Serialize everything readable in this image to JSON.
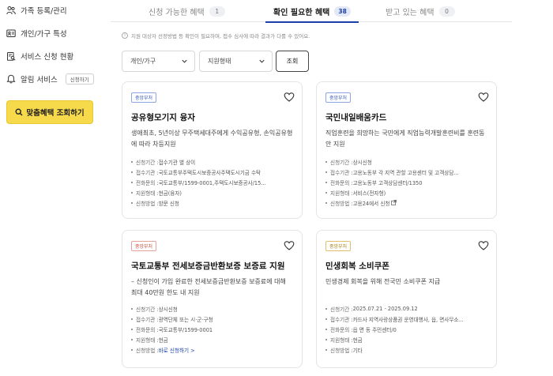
{
  "sidebar": {
    "items": [
      {
        "label": "가족 등록/관리",
        "icon": "people-icon"
      },
      {
        "label": "개인/가구 특성",
        "icon": "id-card-icon"
      },
      {
        "label": "서비스 신청 현황",
        "icon": "clipboard-search-icon"
      },
      {
        "label": "알림 서비스",
        "icon": "bell-icon",
        "button": "신청하기"
      }
    ],
    "cta_label": "맞춤혜택 조회하기"
  },
  "tabs": [
    {
      "label": "신청 가능한 혜택",
      "count": "1"
    },
    {
      "label": "확인 필요한 혜택",
      "count": "38"
    },
    {
      "label": "받고 있는 혜택",
      "count": "0"
    }
  ],
  "notice": "지원 대상자 선정방법 등 확인이 필요하며, 접수 심사에 따라 결과가 다를 수 있어요.",
  "filters": {
    "household": "개인/가구",
    "support_type": "지원형태",
    "search_label": "조회"
  },
  "cards": [
    {
      "badge": "중앙부처",
      "badge_color": "blue",
      "title": "공유형모기지 융자",
      "desc": "생애최초, 5년이상 무주택세대주에게 수익공유형, 손익공유형에 따라 차등지원",
      "details": [
        {
          "label": "신청기간 : ",
          "value": "접수기관 별 상이"
        },
        {
          "label": "접수기관 : ",
          "value": "국토교통부주택도시보증공사주택도시기금 수탁"
        },
        {
          "label": "전화문의 : ",
          "value": "국토교통부/1599-0001,주택도시보증공사/15..."
        },
        {
          "label": "지원형태 : ",
          "value": "현금(융자)"
        },
        {
          "label": "신청방법 : ",
          "value": "방문 신청"
        }
      ]
    },
    {
      "badge": "중앙부처",
      "badge_color": "blue",
      "title": "국민내일배움카드",
      "desc": "직업훈련을 희망하는 국민에게 직업능력개발훈련비를 훈련동안 지원",
      "details": [
        {
          "label": "신청기간 : ",
          "value": "상시신청"
        },
        {
          "label": "접수기관 : ",
          "value": "고용노동부 각 지역 관할 고용센터 및 고객상담..."
        },
        {
          "label": "전화문의 : ",
          "value": "고용노동부 고객상담센터/1350"
        },
        {
          "label": "지원형태 : ",
          "value": "서비스(전자형)"
        },
        {
          "label": "신청방법 : ",
          "value": "고용24에서 신청",
          "link": true,
          "ext": true
        }
      ]
    },
    {
      "badge": "중앙부처",
      "badge_color": "red",
      "title": "국토교통부 전세보증금반환보증 보증료 지원",
      "desc": "– 신청인이 가입 완료한 전세보증금반환보증 보증료에 대해 최대 40만원 한도 내 지원",
      "details": [
        {
          "label": "신청기간 : ",
          "value": "상시신청"
        },
        {
          "label": "접수기관 : ",
          "value": "광역단체 또는 시·군·구청"
        },
        {
          "label": "전화문의 : ",
          "value": "국토교통부/1599-0001"
        },
        {
          "label": "지원형태 : ",
          "value": "현금"
        },
        {
          "label": "신청방법 : ",
          "value": "바로 신청하기 >",
          "link": true
        }
      ]
    },
    {
      "badge": "중앙부처",
      "badge_color": "yellow",
      "title": "민생회복 소비쿠폰",
      "desc": "민생경제 회복을 위해 전국민 소비쿠폰 지급",
      "details": [
        {
          "label": "신청기간 : ",
          "value": "2025.07.21 - 2025.09.12"
        },
        {
          "label": "접수기관 : ",
          "value": "카드사 지역사랑상품권 운영대행사, 읍, 면사무소..."
        },
        {
          "label": "전화문의 : ",
          "value": "읍 면 동 주민센터/0"
        },
        {
          "label": "지원형태 : ",
          "value": "현금"
        },
        {
          "label": "신청방법 : ",
          "value": "기타"
        }
      ]
    }
  ],
  "colors": {
    "accent": "#1a3fa8",
    "cta": "#f7d94c"
  }
}
